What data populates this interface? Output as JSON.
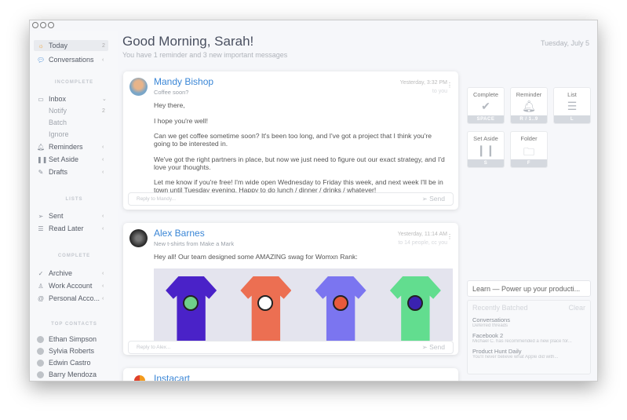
{
  "sidebar": {
    "top": [
      {
        "label": "Today",
        "icon": "sun-icon",
        "right": "2"
      },
      {
        "label": "Conversations",
        "icon": "chat-icon",
        "right": "‹"
      }
    ],
    "incomplete_header": "INCOMPLETE",
    "incomplete": [
      {
        "label": "Inbox",
        "icon": "inbox-icon",
        "right": "⌄"
      },
      {
        "label": "Notify",
        "right": "2"
      },
      {
        "label": "Batch"
      },
      {
        "label": "Ignore"
      },
      {
        "label": "Reminders",
        "icon": "bell-icon",
        "right": "‹"
      },
      {
        "label": "Set Aside",
        "icon": "pause-icon",
        "right": "‹"
      },
      {
        "label": "Drafts",
        "icon": "draft-icon",
        "right": "‹"
      }
    ],
    "lists_header": "LISTS",
    "lists": [
      {
        "label": "Sent",
        "icon": "send-icon",
        "right": "‹"
      },
      {
        "label": "Read Later",
        "icon": "list-icon",
        "right": "‹"
      }
    ],
    "complete_header": "COMPLETE",
    "complete": [
      {
        "label": "Archive",
        "icon": "check-icon",
        "right": "‹"
      },
      {
        "label": "Work Account",
        "icon": "user-icon",
        "right": "‹"
      },
      {
        "label": "Personal Acco...",
        "icon": "at-icon",
        "right": "‹"
      }
    ],
    "contacts_header": "TOP CONTACTS",
    "contacts": [
      "Ethan Simpson",
      "Sylvia Roberts",
      "Edwin Castro",
      "Barry Mendoza"
    ]
  },
  "header": {
    "title": "Good Morning, Sarah!",
    "subtitle": "You have 1 reminder and 3 new important messages",
    "date": "Tuesday, July 5"
  },
  "messages": [
    {
      "name": "Mandy Bishop",
      "subject": "Coffee soon?",
      "time": "Yesterday, 3:32 PM",
      "to": "to you",
      "body": [
        "Hey there,",
        "I hope you're well!",
        "Can we get coffee sometime soon? It's been too long, and I've got a project that I think you're going to be interested in.",
        "We've got the right partners in place, but now we just need to figure out our exact strategy, and I'd love your thoughts.",
        "Let me know if you're free! I'm wide open Wednesday to Friday this week, and next week I'll be in town until Tuesday evening. Happy to do lunch / dinner / drinks / whatever!"
      ],
      "reply_placeholder": "Reply to Mandy...",
      "send": "Send"
    },
    {
      "name": "Alex Barnes",
      "subject": "New t-shirts from Make a Mark",
      "time": "Yesterday, 11:14 AM",
      "to": "to 14 people, cc you",
      "body": [
        "Hey all! Our team designed some AMAZING swag for Womxn Rank:"
      ],
      "tshirt_colors": [
        "#4a22c8",
        "#ec6f52",
        "#7b75f0",
        "#62dd8f"
      ],
      "reply_placeholder": "Reply to Alex...",
      "send": "Send"
    },
    {
      "name": "Instacart"
    }
  ],
  "actions": [
    {
      "label": "Complete",
      "key": "SPACE",
      "icon": "check-icon"
    },
    {
      "label": "Reminder",
      "key": "R / 1..9",
      "icon": "bell-icon"
    },
    {
      "label": "List",
      "key": "L",
      "icon": "list-icon"
    },
    {
      "label": "Set Aside",
      "key": "S",
      "icon": "pause-icon"
    },
    {
      "label": "Folder",
      "key": "F",
      "icon": "folder-icon"
    }
  ],
  "learn": "Learn — Power up your producti...",
  "recent": {
    "title": "Recently Batched",
    "clear": "Clear",
    "items": [
      {
        "title": "Conversations",
        "desc": "Deferred threads"
      },
      {
        "title": "Facebook",
        "count": "2",
        "desc": "Michael C. has recommended a new place for..."
      },
      {
        "title": "Product Hunt Daily",
        "desc": "You'll never believe what Apple did with..."
      }
    ]
  },
  "colors": {
    "accent": "#3a86d6"
  }
}
